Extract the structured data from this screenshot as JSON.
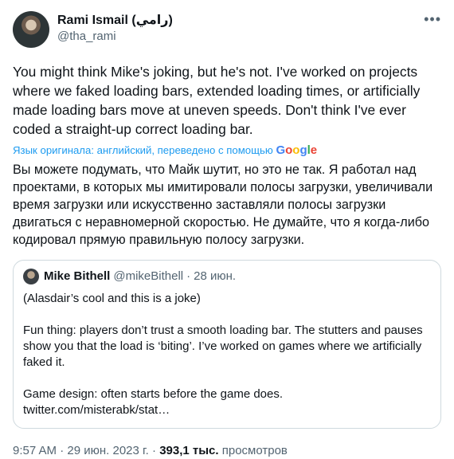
{
  "author": {
    "display_name": "Rami Ismail (رامي)",
    "handle": "@tha_rami",
    "more_icon": "more-horizontal-icon"
  },
  "tweet": {
    "text": "You might think Mike's joking, but he's not. I've worked on projects where we faked loading bars, extended loading times, or artificially made loading bars move at uneven speeds. Don't think I've ever coded a straight-up correct loading bar.",
    "translation_note": "Язык оригинала: английский, переведено с помощью",
    "translation_provider": "Google",
    "translated_text": "Вы можете подумать, что Майк шутит, но это не так. Я работал над проектами, в которых мы имитировали полосы загрузки, увеличивали время загрузки или искусственно заставляли полосы загрузки двигаться с неравномерной скоростью. Не думайте, что я когда-либо кодировал прямую правильную полосу загрузки."
  },
  "quote": {
    "display_name": "Mike Bithell",
    "handle": "@mikeBithell",
    "separator": "·",
    "date": "28 июн.",
    "paragraphs": [
      "(Alasdair’s cool and this is a joke)",
      "Fun thing: players don’t trust a smooth loading bar. The stutters and pauses show you that the load is ‘biting’. I’ve worked on games where we artificially faked it.",
      "Game design: often starts before the game does. twitter.com/misterabk/stat…"
    ]
  },
  "meta": {
    "time": "9:57 AM",
    "separator": "·",
    "date": "29 июн. 2023 г.",
    "views_count": "393,1 тыс.",
    "views_label": "просмотров"
  },
  "colors": {
    "accent": "#1d9bf0",
    "secondary_text": "#536471",
    "border": "#cfd9de"
  }
}
